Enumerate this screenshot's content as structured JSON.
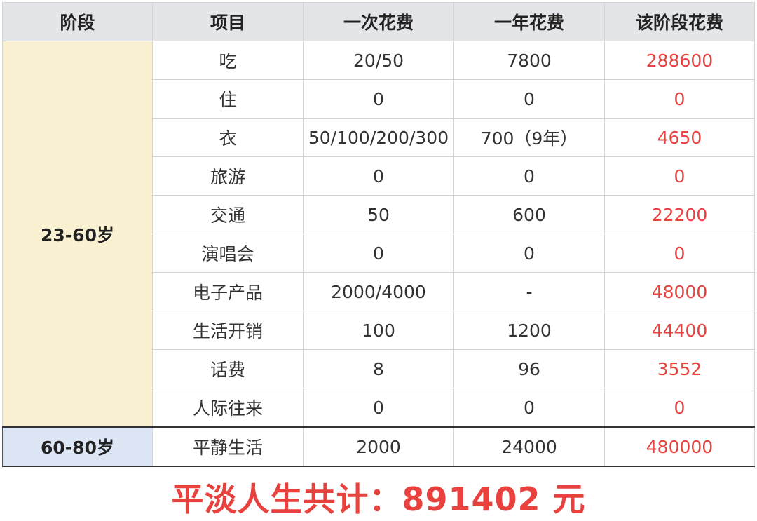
{
  "table": {
    "headers": [
      "阶段",
      "项目",
      "一次花费",
      "一年花费",
      "该阶段花费"
    ],
    "stage1": {
      "label": "23-60岁",
      "rows": [
        {
          "item": "吃",
          "once": "20/50",
          "year": "7800",
          "stage_total": "288600"
        },
        {
          "item": "住",
          "once": "0",
          "year": "0",
          "stage_total": "0"
        },
        {
          "item": "衣",
          "once": "50/100/200/300",
          "year": "700（9年）",
          "stage_total": "4650"
        },
        {
          "item": "旅游",
          "once": "0",
          "year": "0",
          "stage_total": "0"
        },
        {
          "item": "交通",
          "once": "50",
          "year": "600",
          "stage_total": "22200"
        },
        {
          "item": "演唱会",
          "once": "0",
          "year": "0",
          "stage_total": "0"
        },
        {
          "item": "电子产品",
          "once": "2000/4000",
          "year": "-",
          "stage_total": "48000"
        },
        {
          "item": "生活开销",
          "once": "100",
          "year": "1200",
          "stage_total": "44400"
        },
        {
          "item": "话费",
          "once": "8",
          "year": "96",
          "stage_total": "3552"
        },
        {
          "item": "人际往来",
          "once": "0",
          "year": "0",
          "stage_total": "0"
        }
      ]
    },
    "stage2": {
      "label": "60-80岁",
      "rows": [
        {
          "item": "平静生活",
          "once": "2000",
          "year": "24000",
          "stage_total": "480000"
        }
      ]
    }
  },
  "summary": {
    "text": "平淡人生共计：891402 元"
  },
  "colors": {
    "header_bg": "#e3e5e8",
    "stage1_bg": "#faf0d2",
    "stage2_bg": "#dce6f5",
    "highlight_red": "#e8413e"
  }
}
